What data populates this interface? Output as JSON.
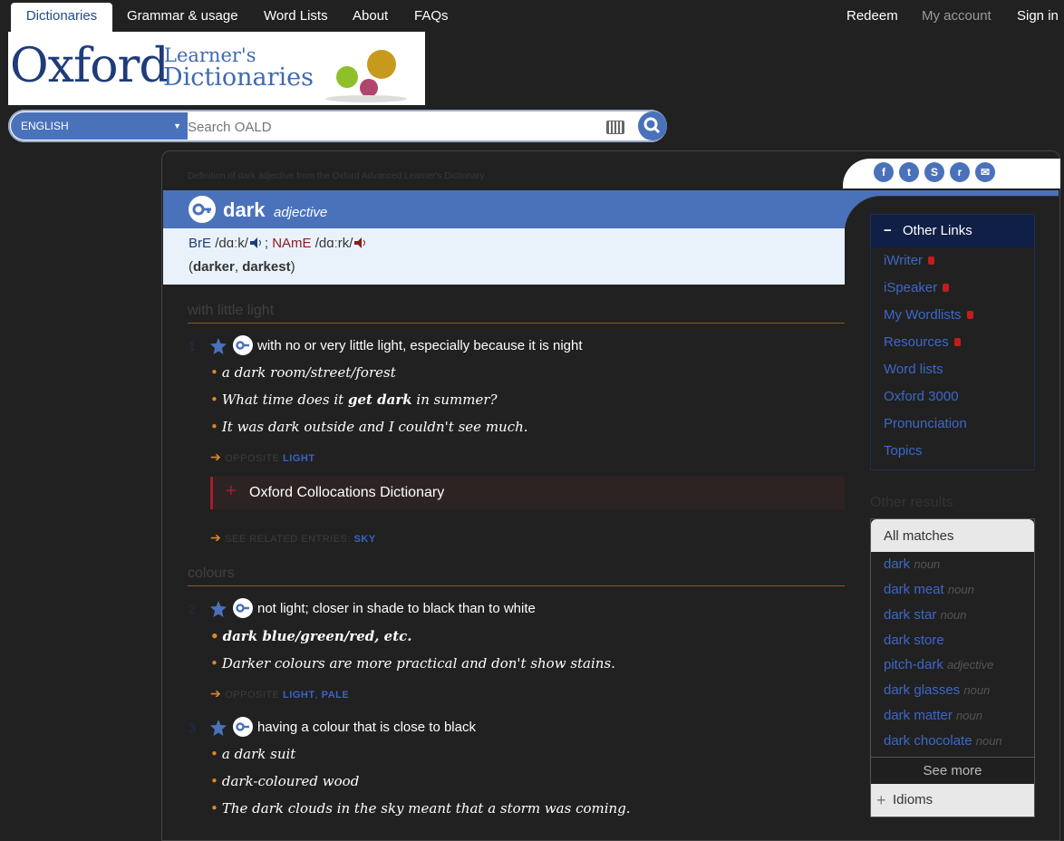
{
  "nav": {
    "tabs": [
      "Dictionaries",
      "Grammar & usage",
      "Word Lists",
      "About",
      "FAQs"
    ],
    "redeem": "Redeem",
    "my_account": "My account",
    "sign_in": "Sign in"
  },
  "logo": {
    "oxford": "Oxford",
    "learners": "Learner's",
    "dictionaries": "Dictionaries"
  },
  "search": {
    "language": "ENGLISH",
    "placeholder": "Search OALD"
  },
  "entry": {
    "source": "Definition of dark adjective from the Oxford Advanced Learner's Dictionary",
    "headword": "dark",
    "pos": "adjective",
    "bre_label": "BrE",
    "bre_ipa": "/dɑːk/",
    "name_label": "NAmE",
    "name_ipa": "/dɑːrk/",
    "forms_open": "(",
    "form1": "darker",
    "form_sep": ", ",
    "form2": "darkest",
    "forms_close": ")"
  },
  "senses": {
    "head1": "with little light",
    "s1": {
      "num": "1",
      "def": "with no or very little light, especially because it is night",
      "ex1": "a dark room/street/forest",
      "ex2_pre": "What time does it ",
      "ex2_bold": "get dark",
      "ex2_post": " in summer?",
      "ex3": "It was dark outside and I couldn't see much.",
      "opp_label": "OPPOSITE",
      "opp_link": "LIGHT",
      "colloc": "Oxford Collocations Dictionary",
      "see_label": "SEE RELATED ENTRIES:",
      "see_link": "SKY"
    },
    "head2": "colours",
    "s2": {
      "num": "2",
      "def": "not light; closer in shade to black than to white",
      "ex1": "dark blue/green/red, etc.",
      "ex2": "Darker colours are more practical and don't show stains.",
      "opp_label": "OPPOSITE",
      "opp_link1": "LIGHT",
      "opp_sep": ", ",
      "opp_link2": "PALE"
    },
    "s3": {
      "num": "3",
      "def": "having a colour that is close to black",
      "ex1": "a dark suit",
      "ex2": "dark-coloured wood",
      "ex3": "The dark clouds in the sky meant that a storm was coming."
    }
  },
  "other_links": {
    "title": "Other Links",
    "items": [
      "iWriter",
      "iSpeaker",
      "My Wordlists",
      "Resources",
      "Word lists",
      "Oxford 3000",
      "Pronunciation",
      "Topics"
    ]
  },
  "other_results": {
    "title": "Other results",
    "all_matches": "All matches",
    "items": [
      {
        "word": "dark",
        "pos": "noun"
      },
      {
        "word": "dark meat",
        "pos": "noun"
      },
      {
        "word": "dark star",
        "pos": "noun"
      },
      {
        "word": "dark store",
        "pos": ""
      },
      {
        "word": "pitch-dark",
        "pos": "adjective"
      },
      {
        "word": "dark glasses",
        "pos": "noun"
      },
      {
        "word": "dark matter",
        "pos": "noun"
      },
      {
        "word": "dark chocolate",
        "pos": "noun"
      }
    ],
    "see_more": "See more",
    "idioms": "Idioms"
  },
  "colors": {
    "accent": "#4a72bb",
    "dark_bg": "#212121",
    "link": "#3d67c9",
    "bullet": "#e0852e",
    "name_red": "#8a1c1c"
  }
}
